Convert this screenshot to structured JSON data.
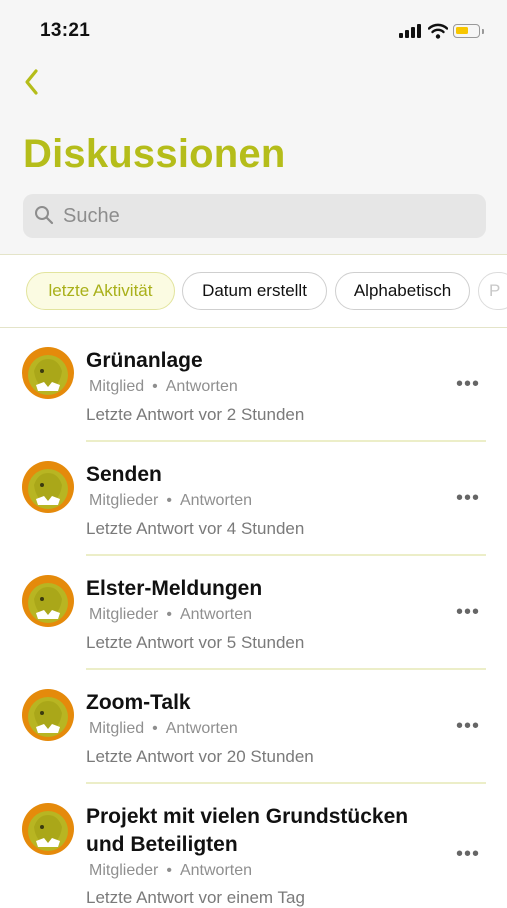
{
  "status_bar": {
    "time": "13:21"
  },
  "header": {
    "back_icon": "chevron-left-icon",
    "title": "Diskussionen",
    "accent_color": "#b5bd1a"
  },
  "search": {
    "placeholder": "Suche",
    "icon": "search-icon"
  },
  "filters": [
    {
      "label": "letzte Aktivität",
      "active": true
    },
    {
      "label": "Datum erstellt",
      "active": false
    },
    {
      "label": "Alphabetisch",
      "active": false
    },
    {
      "label": "P",
      "active": false
    }
  ],
  "discussions": [
    {
      "title": "Grünanlage",
      "members": "Mitglied",
      "replies": "Antworten",
      "last": "Letzte Antwort vor 2 Stunden"
    },
    {
      "title": "Senden",
      "members": "Mitglieder",
      "replies": "Antworten",
      "last": "Letzte Antwort vor 4 Stunden"
    },
    {
      "title": "Elster-Meldungen",
      "members": "Mitglieder",
      "replies": "Antworten",
      "last": "Letzte Antwort vor 5 Stunden"
    },
    {
      "title": "Zoom-Talk",
      "members": "Mitglied",
      "replies": "Antworten",
      "last": "Letzte Antwort vor 20 Stunden"
    },
    {
      "title_line1": "Projekt mit vielen Grundstücken",
      "title_line2": "und Beteiligten",
      "members": "Mitglieder",
      "replies": "Antworten",
      "last": "Letzte Antwort vor einem Tag"
    }
  ],
  "separator": "•",
  "more_label": "•••"
}
